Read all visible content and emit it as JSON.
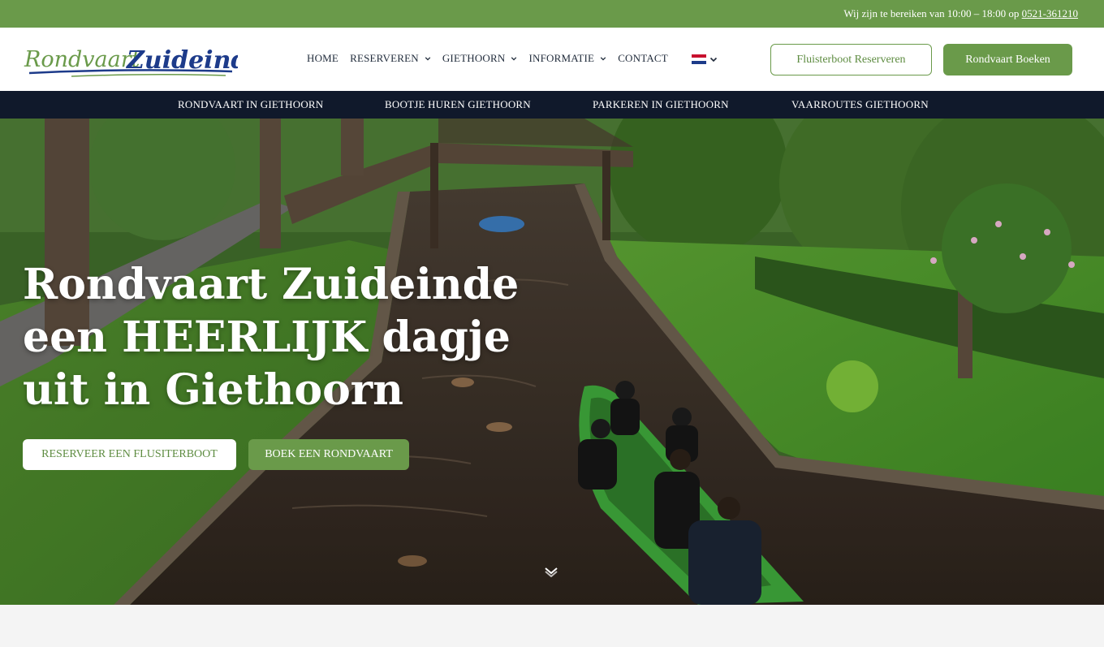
{
  "topbar": {
    "text": "Wij zijn te bereiken van 10:00 – 18:00 op ",
    "phone": "0521-361210"
  },
  "logo": {
    "text_part1": "Rondvaart",
    "text_part2": "Zuideinde"
  },
  "nav": {
    "items": [
      {
        "label": "HOME",
        "dropdown": false
      },
      {
        "label": "RESERVEREN",
        "dropdown": true
      },
      {
        "label": "GIETHOORN",
        "dropdown": true
      },
      {
        "label": "INFORMATIE",
        "dropdown": true
      },
      {
        "label": "CONTACT",
        "dropdown": false
      }
    ],
    "language_icon": "flag-nl-icon"
  },
  "header_buttons": {
    "outline": "Fluisterboot Reserveren",
    "fill": "Rondvaart Boeken"
  },
  "subnav": {
    "items": [
      "RONDVAART IN GIETHOORN",
      "BOOTJE HUREN GIETHOORN",
      "PARKEREN IN GIETHOORN",
      "VAARROUTES GIETHOORN"
    ]
  },
  "hero": {
    "title": "Rondvaart Zuideinde een HEERLIJK dagje uit in Giethoorn",
    "button1": "RESERVEER EEN FLUSITERBOOT",
    "button2": "BOEK EEN RONDVAART",
    "scroll_icon": "chevron-down-icon"
  },
  "colors": {
    "brand_green": "#6a9a4a",
    "navy": "#10192b",
    "logo_blue": "#1d3b8a"
  }
}
